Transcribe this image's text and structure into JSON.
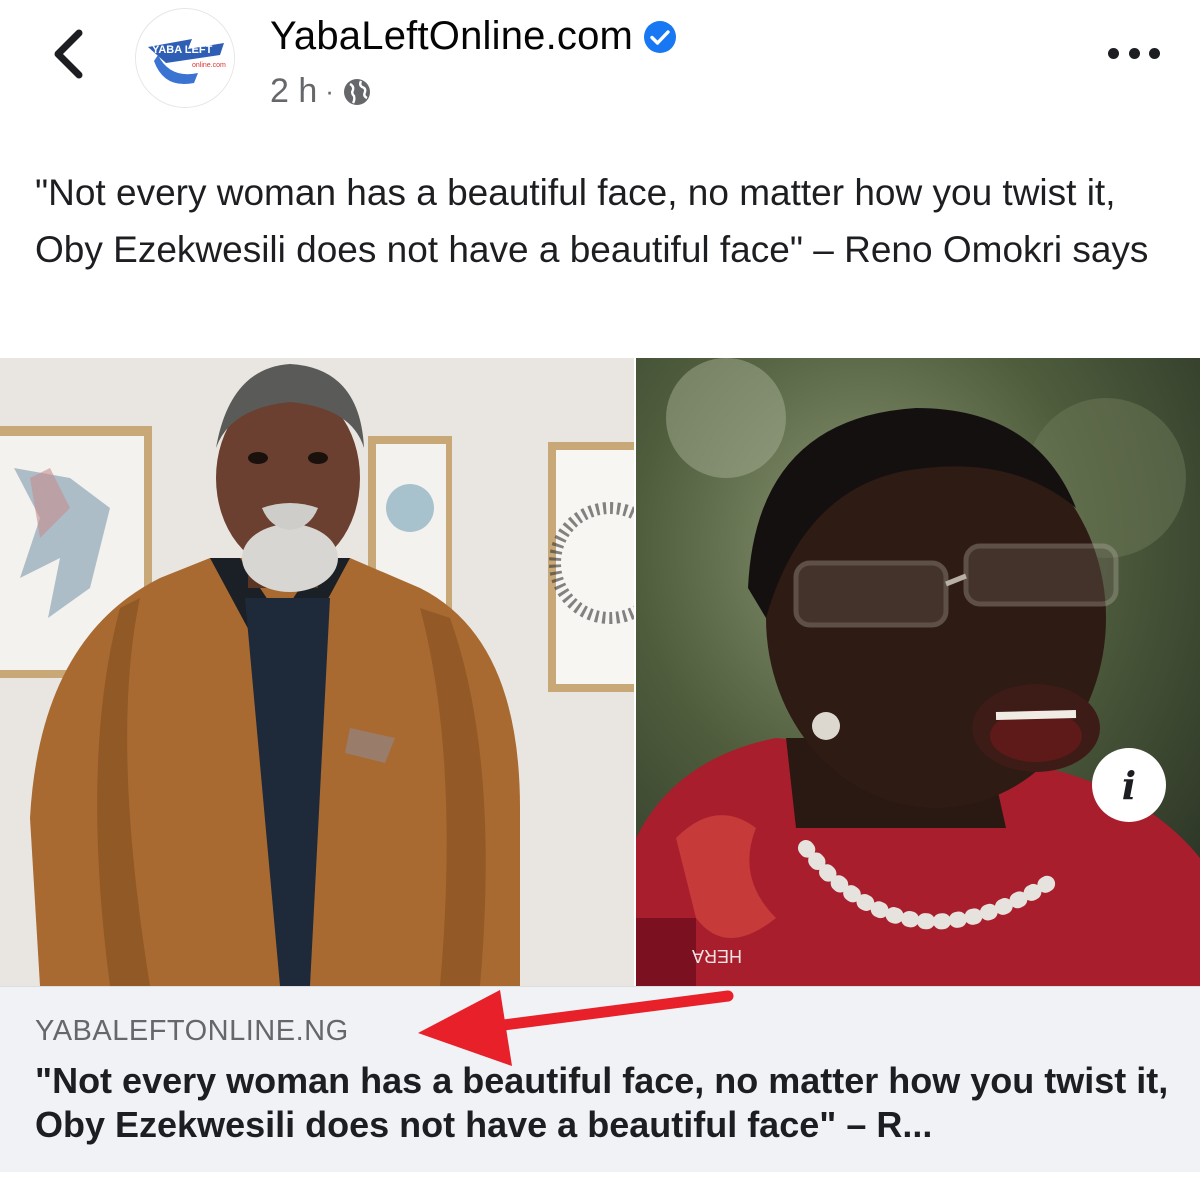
{
  "header": {
    "page_name": "YabaLeftOnline.com",
    "time_ago": "2 h",
    "separator": "·",
    "avatar_brand_text": "YABA LEFT",
    "avatar_brand_subtext": "online.com"
  },
  "post": {
    "text": "\"Not every woman has a beautiful face, no matter how you twist it, Oby Ezekwesili does not have a beautiful face\" – Reno Omokri says"
  },
  "media": {
    "info_label": "i",
    "shirt_text": "HERA"
  },
  "link_preview": {
    "domain": "YABALEFTONLINE.NG",
    "title": "\"Not every woman has a beautiful face, no matter how you twist it, Oby Ezekwesili does not have a beautiful face\" – R..."
  },
  "colors": {
    "verified_badge": "#1877f2",
    "annotation_arrow": "#e8202a",
    "link_card_bg": "#f0f2f5",
    "secondary_text": "#65676b"
  },
  "icons": [
    "chevron-left-icon",
    "verified-badge-icon",
    "globe-icon",
    "more-dots-icon",
    "info-icon",
    "arrow-annotation-icon"
  ]
}
